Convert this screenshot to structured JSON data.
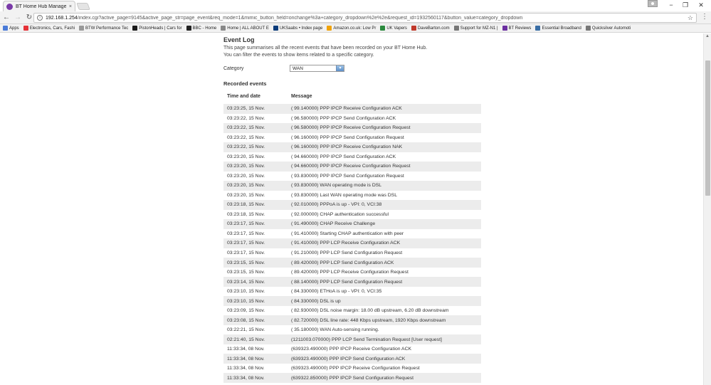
{
  "browser": {
    "tab_title": "BT Home Hub Manager",
    "tab_close": "×",
    "win_minimize": "−",
    "win_restore": "❐",
    "win_close": "✕",
    "back": "←",
    "forward": "→",
    "reload": "↻",
    "page_icon": "i",
    "url_host": "192.168.1.254",
    "url_path": "/index.cgi?active_page=9145&active_page_str=page_event&req_mode=1&mimic_button_field=onchange%3a+category_dropdown%2e%2e&request_id=1932560117&button_value=category_dropdown",
    "star": "☆",
    "menu": "⋮"
  },
  "bookmarks": [
    {
      "label": "Apps",
      "icon_color": "#4a7bd8"
    },
    {
      "label": "Electronics, Cars, Fashi",
      "icon_color": "#e53238"
    },
    {
      "label": "BTW Performance Tec",
      "icon_color": "#999999"
    },
    {
      "label": "PistonHeads | Cars for",
      "icon_color": "#1a1a1a"
    },
    {
      "label": "BBC - Home",
      "icon_color": "#222222"
    },
    {
      "label": "Home | ALL ABOUT E",
      "icon_color": "#888888"
    },
    {
      "label": "UKSaabs • Index page",
      "icon_color": "#0b3b7a"
    },
    {
      "label": "Amazon.co.uk: Low Pr",
      "icon_color": "#f0a30a"
    },
    {
      "label": "UK Vapers",
      "icon_color": "#2b8a3e"
    },
    {
      "label": "DaveBarton.com",
      "icon_color": "#c0392b"
    },
    {
      "label": "Support for MZ-N1 |",
      "icon_color": "#777777"
    },
    {
      "label": "BT Reviews",
      "icon_color": "#6b2fa0"
    },
    {
      "label": "Essential Broadband",
      "icon_color": "#3a6ea5"
    },
    {
      "label": "Quicksilver Automoti",
      "icon_color": "#777777"
    }
  ],
  "page": {
    "title": "Event Log",
    "description_line1": "This page summarises all the recent events that have been recorded on your BT Home Hub.",
    "description_line2": "You can filter the events to show items related to a specific category.",
    "category_label": "Category",
    "category_value": "WAN",
    "recorded_events_title": "Recorded events",
    "col_time": "Time and date",
    "col_message": "Message",
    "scroll_up": "▲"
  },
  "events": [
    {
      "time": "03:23:25, 15 Nov.",
      "message": "( 99.140000) PPP IPCP Receive Configuration ACK"
    },
    {
      "time": "03:23:22, 15 Nov.",
      "message": "( 96.580000) PPP IPCP Send Configuration ACK"
    },
    {
      "time": "03:23:22, 15 Nov.",
      "message": "( 96.580000) PPP IPCP Receive Configuration Request"
    },
    {
      "time": "03:23:22, 15 Nov.",
      "message": "( 96.160000) PPP IPCP Send Configuration Request"
    },
    {
      "time": "03:23:22, 15 Nov.",
      "message": "( 96.160000) PPP IPCP Receive Configuration NAK"
    },
    {
      "time": "03:23:20, 15 Nov.",
      "message": "( 94.660000) PPP IPCP Send Configuration ACK"
    },
    {
      "time": "03:23:20, 15 Nov.",
      "message": "( 94.660000) PPP IPCP Receive Configuration Request"
    },
    {
      "time": "03:23:20, 15 Nov.",
      "message": "( 93.830000) PPP IPCP Send Configuration Request"
    },
    {
      "time": "03:23:20, 15 Nov.",
      "message": "( 93.830000) WAN operating mode is DSL"
    },
    {
      "time": "03:23:20, 15 Nov.",
      "message": "( 93.830000) Last WAN operating mode was DSL"
    },
    {
      "time": "03:23:18, 15 Nov.",
      "message": "( 92.010000) PPPoA is up - VPI: 0, VCI:38"
    },
    {
      "time": "03:23:18, 15 Nov.",
      "message": "( 92.000000) CHAP authentication successful"
    },
    {
      "time": "03:23:17, 15 Nov.",
      "message": "( 91.490000) CHAP Receive Challenge"
    },
    {
      "time": "03:23:17, 15 Nov.",
      "message": "( 91.410000) Starting CHAP authentication with peer"
    },
    {
      "time": "03:23:17, 15 Nov.",
      "message": "( 91.410000) PPP LCP Receive Configuration ACK"
    },
    {
      "time": "03:23:17, 15 Nov.",
      "message": "( 91.210000) PPP LCP Send Configuration Request"
    },
    {
      "time": "03:23:15, 15 Nov.",
      "message": "( 89.420000) PPP LCP Send Configuration ACK"
    },
    {
      "time": "03:23:15, 15 Nov.",
      "message": "( 89.420000) PPP LCP Receive Configuration Request"
    },
    {
      "time": "03:23:14, 15 Nov.",
      "message": "( 88.140000) PPP LCP Send Configuration Request"
    },
    {
      "time": "03:23:10, 15 Nov.",
      "message": "( 84.330000) ETHoA is up - VPI: 0, VCI:35"
    },
    {
      "time": "03:23:10, 15 Nov.",
      "message": "( 84.330000) DSL is up"
    },
    {
      "time": "03:23:09, 15 Nov.",
      "message": "( 82.930000) DSL noise margin: 18.00 dB upstream, 6.20 dB downstream"
    },
    {
      "time": "03:23:08, 15 Nov.",
      "message": "( 82.720000) DSL line rate: 448 Kbps upstream, 1920 Kbps downstream"
    },
    {
      "time": "03:22:21, 15 Nov.",
      "message": "( 35.180000) WAN Auto-sensing running."
    },
    {
      "time": "02:21:40, 15 Nov.",
      "message": "(1211003.070000) PPP LCP Send Termination Request [User request]"
    },
    {
      "time": "11:33:34, 08 Nov.",
      "message": "(639323.490000) PPP IPCP Receive Configuration ACK"
    },
    {
      "time": "11:33:34, 08 Nov.",
      "message": "(639323.490000) PPP IPCP Send Configuration ACK"
    },
    {
      "time": "11:33:34, 08 Nov.",
      "message": "(639323.490000) PPP IPCP Receive Configuration Request"
    },
    {
      "time": "11:33:34, 08 Nov.",
      "message": "(639322.850000) PPP IPCP Send Configuration Request"
    }
  ]
}
